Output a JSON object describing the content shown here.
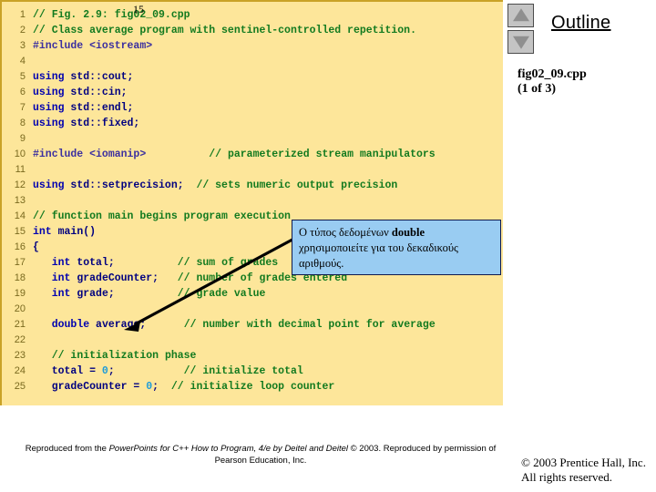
{
  "page_number": "15",
  "outline": {
    "title": "Outline",
    "nav_up_icon": "triangle-up-icon",
    "nav_down_icon": "triangle-down-icon",
    "file_name": "fig02_09.cpp",
    "file_part": "(1 of 3)"
  },
  "callout": {
    "text_before": "Ο τύπος δεδομένων ",
    "bold_term": "double",
    "text_after": "χρησιμοποιείτε για του δεκαδικούς αριθμούς."
  },
  "footer": {
    "attribution_prefix": "Reproduced from the ",
    "attribution_italic": "PowerPoints for C++ How to Program, 4/e by Deitel and Deitel",
    "attribution_suffix": " © 2003. Reproduced by permission of Pearson Education, Inc.",
    "copyright_line1": "© 2003 Prentice Hall, Inc.",
    "copyright_line2": "All rights reserved."
  },
  "colors": {
    "panel_background": "#fde69a",
    "panel_border": "#c9a227",
    "comment": "#127a1f",
    "keyword": "#0000b0",
    "identifier": "#000080",
    "number": "#1e9bd8",
    "line_number": "#7a6a1f",
    "callout_background": "#99ccf2",
    "callout_border": "#101a4d",
    "nav_button": "#c4c4c4"
  },
  "code": [
    {
      "n": "1",
      "segments": [
        {
          "t": "// Fig. 2.9: fig02_09.cpp",
          "c": "cmt"
        }
      ]
    },
    {
      "n": "2",
      "segments": [
        {
          "t": "// Class average program with sentinel-controlled repetition.",
          "c": "cmt"
        }
      ]
    },
    {
      "n": "3",
      "segments": [
        {
          "t": "#include ",
          "c": "pp"
        },
        {
          "t": "<iostream>",
          "c": "pp"
        }
      ]
    },
    {
      "n": "4",
      "segments": []
    },
    {
      "n": "5",
      "segments": [
        {
          "t": "using",
          "c": "kw"
        },
        {
          "t": " std::cout;",
          "c": "code-text"
        }
      ]
    },
    {
      "n": "6",
      "segments": [
        {
          "t": "using",
          "c": "kw"
        },
        {
          "t": " std::cin;",
          "c": "code-text"
        }
      ]
    },
    {
      "n": "7",
      "segments": [
        {
          "t": "using",
          "c": "kw"
        },
        {
          "t": " std::endl;",
          "c": "code-text"
        }
      ]
    },
    {
      "n": "8",
      "segments": [
        {
          "t": "using",
          "c": "kw"
        },
        {
          "t": " std::fixed;",
          "c": "code-text"
        }
      ]
    },
    {
      "n": "9",
      "segments": []
    },
    {
      "n": "10",
      "segments": [
        {
          "t": "#include ",
          "c": "pp"
        },
        {
          "t": "<iomanip>",
          "c": "pp"
        },
        {
          "t": "          ",
          "c": "plain"
        },
        {
          "t": "// parameterized stream manipulators",
          "c": "cmt"
        }
      ]
    },
    {
      "n": "11",
      "segments": []
    },
    {
      "n": "12",
      "segments": [
        {
          "t": "using",
          "c": "kw"
        },
        {
          "t": " std::setprecision;",
          "c": "code-text"
        },
        {
          "t": "  ",
          "c": "plain"
        },
        {
          "t": "// sets numeric output precision",
          "c": "cmt"
        }
      ]
    },
    {
      "n": "13",
      "segments": []
    },
    {
      "n": "14",
      "segments": [
        {
          "t": "// function main begins program execution",
          "c": "cmt"
        }
      ]
    },
    {
      "n": "15",
      "segments": [
        {
          "t": "int",
          "c": "kw"
        },
        {
          "t": " main()",
          "c": "code-text"
        }
      ]
    },
    {
      "n": "16",
      "segments": [
        {
          "t": "{",
          "c": "code-text"
        }
      ]
    },
    {
      "n": "17",
      "segments": [
        {
          "t": "   ",
          "c": "plain"
        },
        {
          "t": "int",
          "c": "kw"
        },
        {
          "t": " total;",
          "c": "code-text"
        },
        {
          "t": "          ",
          "c": "plain"
        },
        {
          "t": "// sum of grades",
          "c": "cmt"
        }
      ]
    },
    {
      "n": "18",
      "segments": [
        {
          "t": "   ",
          "c": "plain"
        },
        {
          "t": "int",
          "c": "kw"
        },
        {
          "t": " gradeCounter;",
          "c": "code-text"
        },
        {
          "t": "   ",
          "c": "plain"
        },
        {
          "t": "// number of grades entered",
          "c": "cmt"
        }
      ]
    },
    {
      "n": "19",
      "segments": [
        {
          "t": "   ",
          "c": "plain"
        },
        {
          "t": "int",
          "c": "kw"
        },
        {
          "t": " grade;",
          "c": "code-text"
        },
        {
          "t": "          ",
          "c": "plain"
        },
        {
          "t": "// grade value",
          "c": "cmt"
        }
      ]
    },
    {
      "n": "20",
      "segments": []
    },
    {
      "n": "21",
      "segments": [
        {
          "t": "   ",
          "c": "plain"
        },
        {
          "t": "double",
          "c": "kw"
        },
        {
          "t": " average;",
          "c": "code-text"
        },
        {
          "t": "      ",
          "c": "plain"
        },
        {
          "t": "// number with decimal point for average",
          "c": "cmt"
        }
      ]
    },
    {
      "n": "22",
      "segments": []
    },
    {
      "n": "23",
      "segments": [
        {
          "t": "   ",
          "c": "plain"
        },
        {
          "t": "// initialization phase",
          "c": "cmt"
        }
      ]
    },
    {
      "n": "24",
      "segments": [
        {
          "t": "   total = ",
          "c": "code-text"
        },
        {
          "t": "0",
          "c": "num"
        },
        {
          "t": ";",
          "c": "code-text"
        },
        {
          "t": "           ",
          "c": "plain"
        },
        {
          "t": "// initialize total",
          "c": "cmt"
        }
      ]
    },
    {
      "n": "25",
      "segments": [
        {
          "t": "   gradeCounter = ",
          "c": "code-text"
        },
        {
          "t": "0",
          "c": "num"
        },
        {
          "t": ";",
          "c": "code-text"
        },
        {
          "t": "  ",
          "c": "plain"
        },
        {
          "t": "// initialize loop counter",
          "c": "cmt"
        }
      ]
    }
  ]
}
